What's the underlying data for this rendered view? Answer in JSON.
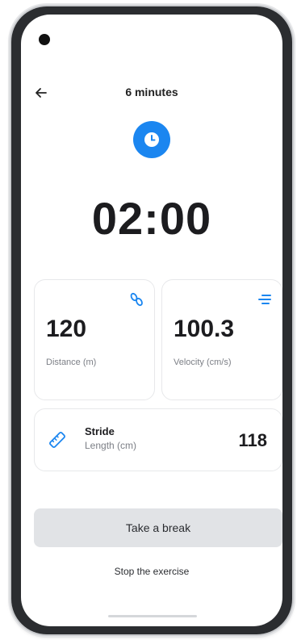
{
  "header": {
    "back_icon": "arrow-left-icon",
    "title": "6 minutes"
  },
  "timer": {
    "icon": "clock-icon",
    "value": "02:00"
  },
  "stats": {
    "distance": {
      "value": "120",
      "label": "Distance (m)",
      "icon": "footsteps-icon"
    },
    "velocity": {
      "value": "100.3",
      "label": "Velocity (cm/s)",
      "icon": "speed-lines-icon"
    },
    "stride": {
      "label_bold": "Stride",
      "label_rest": "Length (cm)",
      "value": "118",
      "icon": "ruler-icon"
    }
  },
  "actions": {
    "break_label": "Take a break",
    "stop_label": "Stop the exercise"
  },
  "colors": {
    "accent": "#1b86f0",
    "button_bg": "#e1e3e6",
    "muted_text": "#7c7f86"
  }
}
